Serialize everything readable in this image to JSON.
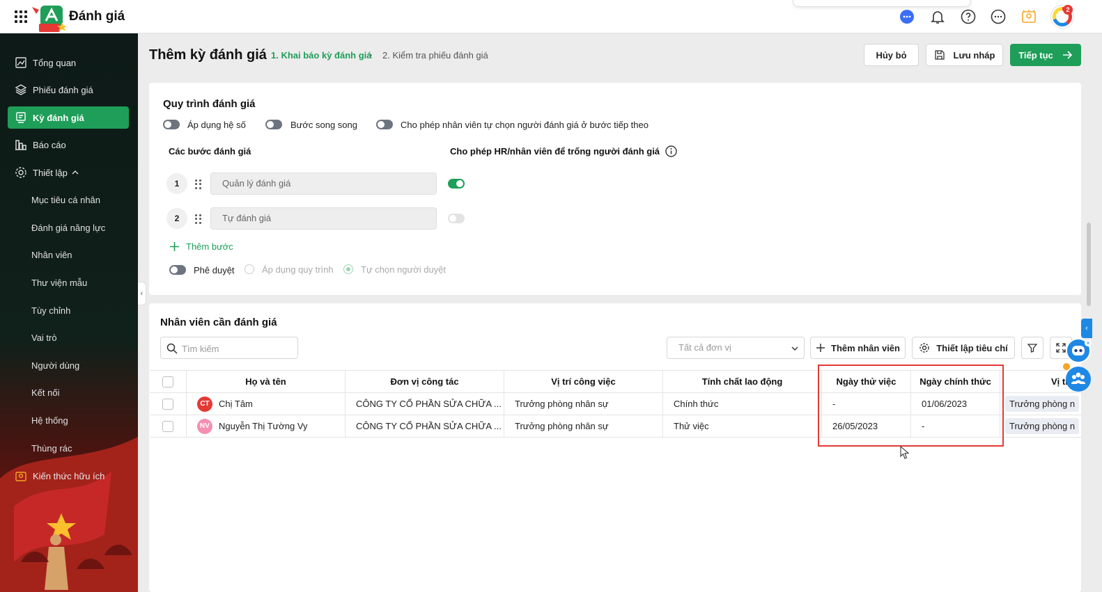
{
  "app": {
    "title": "Đánh giá",
    "notification_count": "2"
  },
  "sidebar": {
    "items": [
      {
        "label": "Tổng quan",
        "icon": "chart-line-icon"
      },
      {
        "label": "Phiếu đánh giá",
        "icon": "layers-icon"
      },
      {
        "label": "Kỳ đánh giá",
        "icon": "form-icon",
        "active": true
      },
      {
        "label": "Báo cáo",
        "icon": "bar-chart-icon"
      },
      {
        "label": "Thiết lập",
        "icon": "gear-icon"
      }
    ],
    "sub_items": [
      "Mục tiêu cá nhân",
      "Đánh giá năng lực",
      "Nhân viên",
      "Thư viện mẫu",
      "Tùy chỉnh",
      "Vai trò",
      "Người dùng",
      "Kết nối",
      "Hệ thống",
      "Thùng rác"
    ],
    "knowledge": "Kiến thức hữu ích"
  },
  "header": {
    "title": "Thêm kỳ đánh giá",
    "step1": "1. Khai báo kỳ đánh giá",
    "step2": "2. Kiểm tra phiếu đánh giá",
    "cancel": "Hủy bỏ",
    "save_draft": "Lưu nháp",
    "next": "Tiếp tục"
  },
  "process": {
    "title": "Quy trình đánh giá",
    "opt1": "Áp dụng hệ số",
    "opt2": "Bước song song",
    "opt3": "Cho phép nhân viên tự chọn người đánh giá ở bước tiếp theo",
    "steps_title": "Các bước đánh giá",
    "allow_empty_title": "Cho phép HR/nhân viên để trống người đánh giá",
    "steps": [
      {
        "num": "1",
        "name": "Quản lý đánh giá",
        "allow_empty": true
      },
      {
        "num": "2",
        "name": "Tự đánh giá",
        "allow_empty": false
      }
    ],
    "add_step": "Thêm bước",
    "approval": "Phê duyệt",
    "approval_opt1": "Áp dụng quy trình",
    "approval_opt2": "Tự chọn người duyệt"
  },
  "employees": {
    "title": "Nhân viên cần đánh giá",
    "search_placeholder": "Tìm kiếm",
    "unit_select": "Tất cả đơn vị",
    "add_employee": "Thêm nhân viên",
    "setup_criteria": "Thiết lập tiêu chí",
    "columns": [
      "Họ và tên",
      "Đơn vị công tác",
      "Vị trí công việc",
      "Tính chất lao động",
      "Ngày thử việc",
      "Ngày chính thức",
      "Vị trí"
    ],
    "rows": [
      {
        "initials": "CT",
        "avatar_color": "#e53935",
        "name": "Chị Tâm",
        "unit": "CÔNG TY CỔ PHẦN SỬA CHỮA ...",
        "position": "Trưởng phòng nhân sự",
        "type": "Chính thức",
        "probation": "-",
        "official": "01/06/2023",
        "extra": "Trưởng phòng n"
      },
      {
        "initials": "NV",
        "avatar_color": "#f48fb1",
        "name": "Nguyễn Thị Tường Vy",
        "unit": "CÔNG TY CỔ PHẦN SỬA CHỮA ...",
        "position": "Trưởng phòng nhân sự",
        "type": "Thử việc",
        "probation": "26/05/2023",
        "official": "-",
        "extra": "Trưởng phòng n"
      }
    ]
  },
  "colors": {
    "accent": "#1e9e58",
    "highlight": "#e53935"
  }
}
